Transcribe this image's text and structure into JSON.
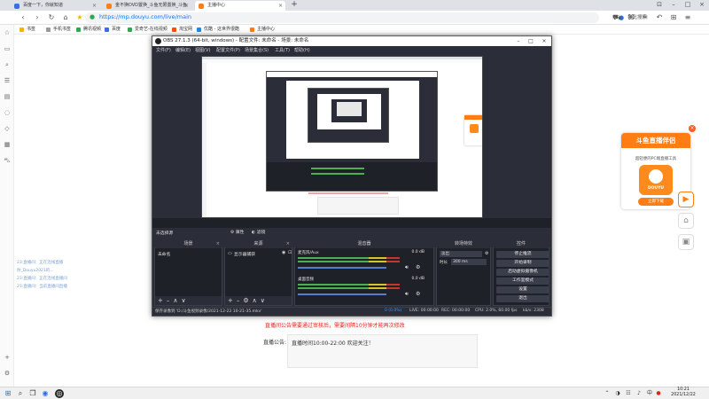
{
  "browser": {
    "tabs": [
      {
        "title": "百度一下，你就知道",
        "icon_color": "#3b6fe0"
      },
      {
        "title": "金不换DVD置换_斗鱼无限置换_斗鱼",
        "icon_color": "#ff7d12"
      },
      {
        "title": "主播中心",
        "icon_color": "#ff7d12"
      }
    ],
    "new_tab": "+",
    "url": "https://mp.douyu.com/live/main",
    "search_placeholder": "在此搜索",
    "bookmarks": [
      {
        "label": "书签",
        "color": "#f5b400"
      },
      {
        "label": "手机书签",
        "color": "#999999"
      },
      {
        "label": "腾讯视频",
        "color": "#2fa84f"
      },
      {
        "label": "百度",
        "color": "#3b6fe0"
      },
      {
        "label": "爱奇艺-在线视频",
        "color": "#2fa84f"
      },
      {
        "label": "淘宝网",
        "color": "#ff5000"
      },
      {
        "label": "优酷 - 这世界很酷",
        "color": "#1e88e5"
      },
      {
        "label": "主播中心",
        "color": "#ff7d12"
      }
    ]
  },
  "page": {
    "side_texts": [
      "23:直播间：正在连线直播",
      "你_Douyu2021的...",
      "23:直播间：正在连线直播间",
      "23:直播间：当前直播间直播"
    ],
    "notice": "直播间公告需要通过审核后，需要间隔10分钟才能再次修改",
    "announce_label": "直播公告:",
    "announce_text": "直播时间10:00-22:00 欢迎关注！"
  },
  "promo": {
    "title": "斗鱼直播伴侣",
    "subtitle": "超轻便的PC端直播工具",
    "logo_text": "DOUYU",
    "button": "立即下载",
    "close": "×"
  },
  "obs": {
    "title": "OBS 27.1.3 (64-bit, windows) - 配置文件: 未命名 - 场景: 未命名",
    "menu": [
      "文件(F)",
      "编辑(E)",
      "视图(V)",
      "配置文件(P)",
      "场景集合(S)",
      "工具(T)",
      "帮助(H)"
    ],
    "no_source": "未选择源",
    "props_button": "属性",
    "filter_button": "滤镜",
    "docks": {
      "scenes": {
        "title": "场景",
        "items": [
          "未命名"
        ]
      },
      "sources": {
        "title": "来源",
        "items": [
          "显示器捕获"
        ]
      },
      "mixer": {
        "title": "混音器",
        "channels": [
          {
            "name": "麦克风/Aux",
            "db": "0.0 dB"
          },
          {
            "name": "桌面音频",
            "db": "0.0 dB"
          }
        ]
      },
      "transitions": {
        "title": "转场特效",
        "type": "淡出",
        "duration_label": "时长",
        "duration": "300 ms"
      },
      "controls": {
        "title": "控件",
        "buttons": [
          "停止推流",
          "开始录制",
          "启动虚拟摄像机",
          "工作室模式",
          "设置",
          "退出"
        ]
      }
    },
    "status": {
      "recording_path": "保存录像到 'D:/斗鱼视频录像/2021-12-22 10-21-35.mkv'",
      "drop": "0 (0.0%)",
      "live": "LIVE: 00:00:00",
      "rec": "REC: 00:00:00",
      "cpu": "CPU: 2.0%, 60.00 fps",
      "kbps": "kb/s: 2308"
    }
  },
  "taskbar": {
    "time": "10:21",
    "date": "2021/12/22"
  }
}
